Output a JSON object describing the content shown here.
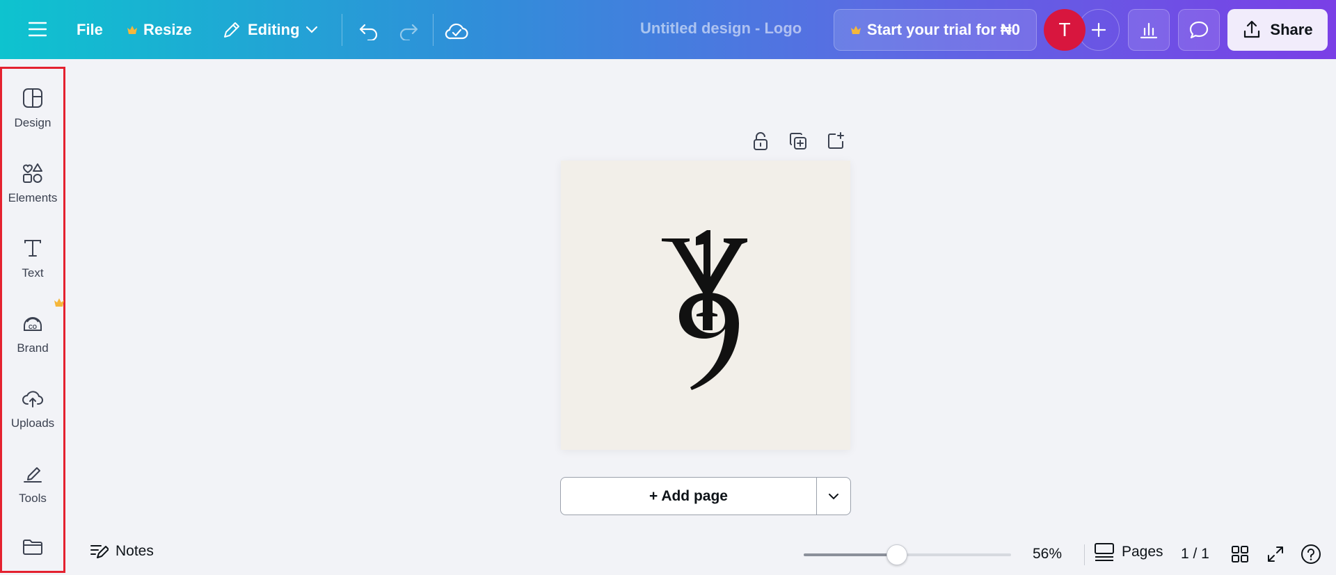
{
  "topbar": {
    "file_label": "File",
    "resize_label": "Resize",
    "editing_label": "Editing",
    "doc_title": "Untitled design - Logo",
    "trial_label": "Start your trial for ₦0",
    "avatar_initial": "T",
    "share_label": "Share",
    "gradient_colors": [
      "#0ec3cf",
      "#2f8fd9",
      "#5a6ce3",
      "#7a3fe6"
    ]
  },
  "sidebar": {
    "items": [
      {
        "label": "Design",
        "icon": "design-icon"
      },
      {
        "label": "Elements",
        "icon": "elements-icon"
      },
      {
        "label": "Text",
        "icon": "text-icon"
      },
      {
        "label": "Brand",
        "icon": "brand-icon"
      },
      {
        "label": "Uploads",
        "icon": "uploads-icon"
      },
      {
        "label": "Tools",
        "icon": "tools-icon"
      },
      {
        "label": "",
        "icon": "projects-folder-icon"
      }
    ]
  },
  "canvas": {
    "add_page_label": "+ Add page"
  },
  "bottombar": {
    "notes_label": "Notes",
    "zoom_label": "56%",
    "zoom_fraction": 0.45,
    "pages_label": "Pages",
    "page_count": "1 / 1"
  }
}
